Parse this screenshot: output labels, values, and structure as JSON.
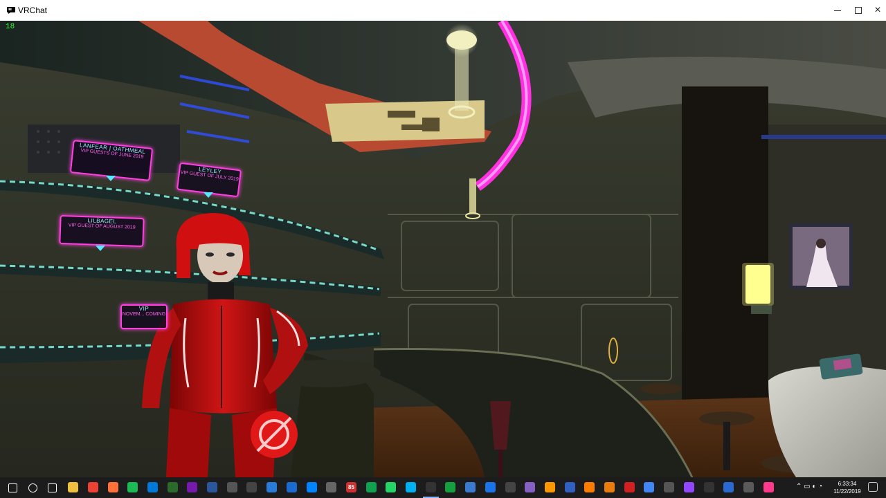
{
  "window": {
    "title": "VRChat"
  },
  "hud": {
    "fps": "18"
  },
  "scene": {
    "vip_signs": [
      {
        "name": "LANFEAR | OATHMEAL",
        "text": "VIP GUESTS OF JUNE 2019"
      },
      {
        "name": "LEYLEY",
        "text": "VIP GUEST OF JULY 2019"
      },
      {
        "name": "LILBAGEL",
        "text": "VIP GUEST OF AUGUST 2019"
      },
      {
        "name": "VIP",
        "text": "NOVEM... COMING"
      }
    ],
    "colors": {
      "neon_pink": "#ff40e0",
      "neon_cyan": "#55e8ff",
      "avatar_red": "#c41010"
    }
  },
  "taskbar": {
    "icons": [
      "start-icon",
      "cortana-icon",
      "task-view-icon",
      "file-explorer-icon",
      "chrome-icon",
      "firefox-icon",
      "spotify-icon",
      "edge-icon",
      "fireworks-icon",
      "onenote-icon",
      "word-icon",
      "mail-icon",
      "calendar-icon",
      "todo-icon",
      "app-icon",
      "messenger-icon",
      "mail-alt-icon",
      "badge-app-icon",
      "phone-icon",
      "whatsapp-icon",
      "skype-icon",
      "vr-icon",
      "green-app-icon",
      "globe-icon",
      "maps-icon",
      "arrow-app-icon",
      "visual-studio-icon",
      "sublime-icon",
      "app-blue-icon",
      "illustrator-icon",
      "blender-icon",
      "red-app-icon",
      "globe-alt-icon",
      "settings-icon",
      "twitch-icon",
      "obs-icon",
      "library-icon",
      "chat-icon",
      "itunes-icon"
    ],
    "badge_count": "85",
    "clock": {
      "time": "6:33:34",
      "date": "11/22/2019"
    }
  }
}
